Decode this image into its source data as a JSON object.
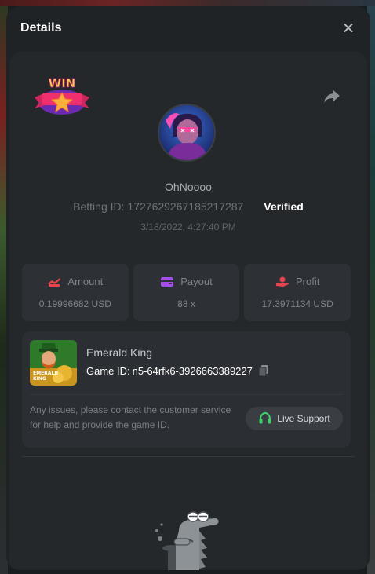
{
  "modal": {
    "title": "Details"
  },
  "bet": {
    "badge_text": "WIN",
    "username": "OhNoooo",
    "betting_id_label": "Betting ID:",
    "betting_id": "1727629267185217287",
    "verified_label": "Verified",
    "timestamp": "3/18/2022, 4:27:40 PM"
  },
  "stats": {
    "amount": {
      "label": "Amount",
      "value": "0.19996682 USD",
      "icon": "amount-icon",
      "color": "#e8434c"
    },
    "payout": {
      "label": "Payout",
      "value": "88 x",
      "icon": "wallet-icon",
      "color": "#a44fe8"
    },
    "profit": {
      "label": "Profit",
      "value": "17.3971134 USD",
      "icon": "profit-icon",
      "color": "#e8434c"
    }
  },
  "game": {
    "name": "Emerald King",
    "id_label": "Game ID:",
    "id": "n5-64rfk6-3926663389227",
    "thumb_text_1": "EMERALD",
    "thumb_text_2": "KING",
    "support_text": "Any issues, please contact the customer service for help and provide the game ID.",
    "support_button": "Live Support",
    "support_icon": "headset-icon",
    "support_icon_color": "#3fd36a"
  }
}
